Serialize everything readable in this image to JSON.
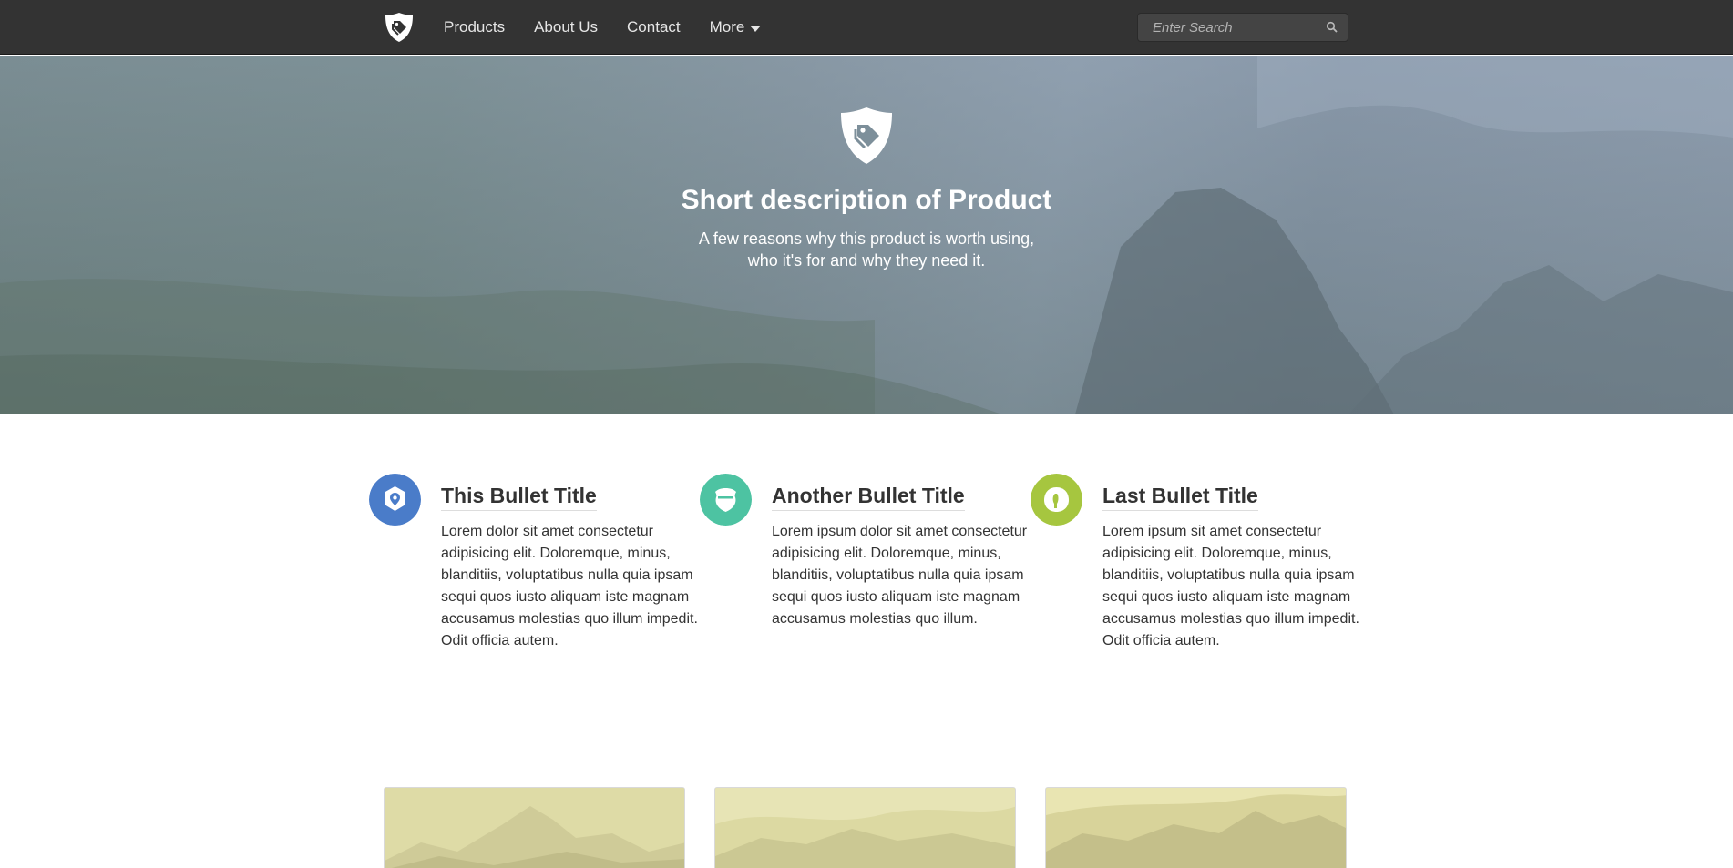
{
  "nav": {
    "links": [
      "Products",
      "About Us",
      "Contact",
      "More"
    ],
    "search_placeholder": "Enter Search",
    "brand_icon": "shield-tag-icon",
    "search_icon": "magnifier-icon"
  },
  "hero": {
    "icon": "shield-tag-icon",
    "title": "Short description of Product",
    "subtitle": "A few reasons why this product is worth using, who it's for and why they need it."
  },
  "bullets": [
    {
      "title": "This Bullet Title",
      "text": "Lorem dolor sit amet consectetur adipisicing elit. Doloremque, minus, blanditiis, voluptatibus nulla quia ipsam sequi quos iusto aliquam iste magnam accusamus molestias quo illum impedit. Odit officia autem.",
      "icon": "map-pin-hexagon-icon",
      "color": "#4a7cc9"
    },
    {
      "title": "Another Bullet Title",
      "text": "Lorem ipsum dolor sit amet consectetur adipisicing elit. Doloremque, minus, blanditiis, voluptatibus nulla quia ipsam sequi quos iusto aliquam iste magnam accusamus molestias quo illum.",
      "icon": "shield-badge-icon",
      "color": "#4dc3a2"
    },
    {
      "title": "Last Bullet Title",
      "text": "Lorem ipsum sit amet consectetur adipisicing elit. Doloremque, minus, blanditiis, voluptatibus nulla quia ipsam sequi quos iusto aliquam iste magnam accusamus molestias quo illum impedit. Odit officia autem.",
      "icon": "leaf-icon",
      "color": "#a6c63f"
    }
  ],
  "colors": {
    "navbar": "#333333",
    "thumb_tint": "#d8d59c"
  }
}
